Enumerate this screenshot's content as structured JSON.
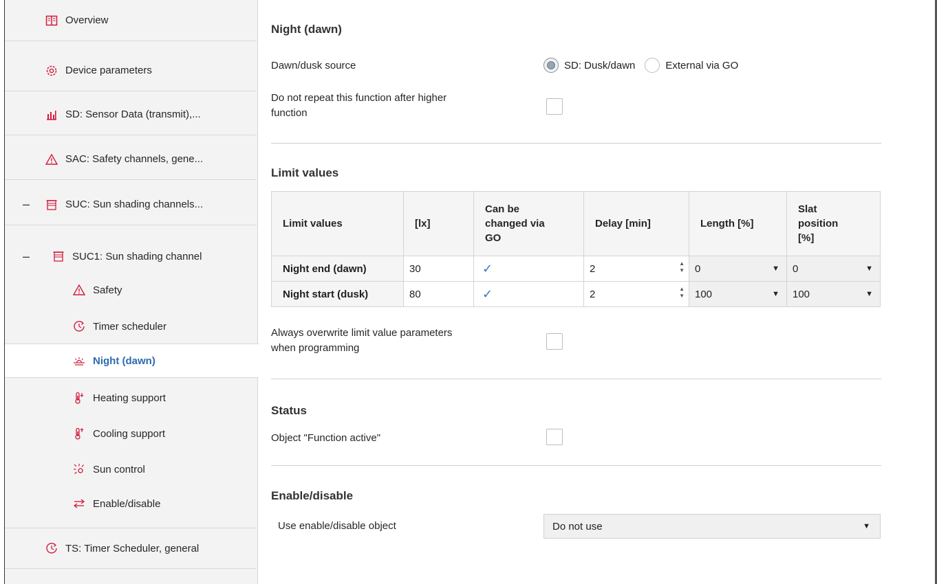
{
  "sidebar": {
    "items": [
      {
        "label": "Overview",
        "icon": "book-icon"
      },
      {
        "label": "Device parameters",
        "icon": "gear-icon"
      },
      {
        "label": "SD: Sensor Data (transmit),...",
        "icon": "sensor-data-icon"
      },
      {
        "label": "SAC: Safety channels, gene...",
        "icon": "warning-icon"
      },
      {
        "label": "SUC: Sun shading channels...",
        "icon": "blind-icon",
        "expander": "–"
      },
      {
        "label": "SUC1:  Sun shading channel",
        "icon": "blind-icon",
        "expander": "–"
      },
      {
        "label": "Safety",
        "icon": "warning-icon"
      },
      {
        "label": "Timer scheduler",
        "icon": "timer-icon"
      },
      {
        "label": "Night (dawn)",
        "icon": "dawn-icon",
        "selected": true
      },
      {
        "label": "Heating support",
        "icon": "thermometer-down-icon"
      },
      {
        "label": "Cooling support",
        "icon": "thermometer-up-icon"
      },
      {
        "label": "Sun control",
        "icon": "sun-icon"
      },
      {
        "label": "Enable/disable",
        "icon": "swap-arrows-icon"
      },
      {
        "label": "TS: Timer Scheduler, general",
        "icon": "timer-icon"
      }
    ]
  },
  "main": {
    "night_title": "Night (dawn)",
    "dawn_dusk_source_label": "Dawn/dusk source",
    "radio_options": [
      {
        "label": "SD: Dusk/dawn",
        "checked": true
      },
      {
        "label": "External via GO",
        "checked": false
      }
    ],
    "no_repeat_label_1": "Do not repeat this function after higher",
    "no_repeat_label_2": "function",
    "limit_values_title": "Limit values",
    "table": {
      "headers": [
        "Limit values",
        "[lx]",
        "Can be\nchanged via\nGO",
        "Delay [min]",
        "Length [%]",
        "Slat\nposition\n[%]"
      ],
      "header_lines": {
        "h0": "Limit values",
        "h1": "[lx]",
        "h2a": "Can be",
        "h2b": "changed via",
        "h2c": "GO",
        "h3": "Delay [min]",
        "h4": "Length [%]",
        "h5a": "Slat",
        "h5b": "position",
        "h5c": "[%]"
      },
      "rows": [
        {
          "name": "Night end (dawn)",
          "lx": "30",
          "changeable": "✓",
          "delay": "2",
          "length": "0",
          "slat": "0"
        },
        {
          "name": "Night start (dusk)",
          "lx": "80",
          "changeable": "✓",
          "delay": "2",
          "length": "100",
          "slat": "100"
        }
      ]
    },
    "overwrite_label_1": "Always overwrite limit value parameters",
    "overwrite_label_2": "when programming",
    "status_title": "Status",
    "function_active_label": "Object \"Function active\"",
    "enable_title": "Enable/disable",
    "use_enable_label": "Use enable/disable object",
    "use_enable_value": "Do not use"
  },
  "colors": {
    "accent": "#d21a3a",
    "selected_text": "#2b6cb0",
    "check": "#3a76c4"
  }
}
